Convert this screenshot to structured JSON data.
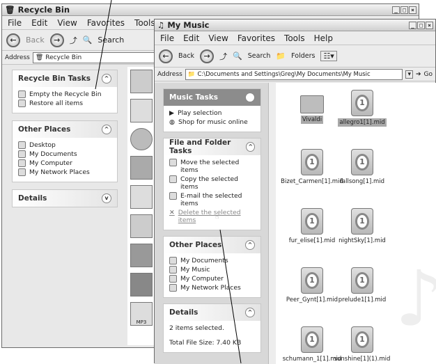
{
  "recycle": {
    "title": "Recycle Bin",
    "menu": [
      "File",
      "Edit",
      "View",
      "Favorites",
      "Tools"
    ],
    "toolbar": {
      "back": "Back",
      "search": "Search"
    },
    "address_label": "Address",
    "address_value": "Recycle Bin",
    "tasks_header": "Recycle Bin Tasks",
    "tasks": [
      "Empty the Recycle Bin",
      "Restore all items"
    ],
    "places_header": "Other Places",
    "places": [
      "Desktop",
      "My Documents",
      "My Computer",
      "My Network Places"
    ],
    "details_header": "Details",
    "strip_label": "MP3"
  },
  "music": {
    "title": "My Music",
    "menu": [
      "File",
      "Edit",
      "View",
      "Favorites",
      "Tools",
      "Help"
    ],
    "toolbar": {
      "back": "Back",
      "search": "Search",
      "folders": "Folders"
    },
    "address_label": "Address",
    "address_value": "C:\\Documents and Settings\\Greg\\My Documents\\My Music",
    "go": "Go",
    "music_tasks_header": "Music Tasks",
    "music_tasks": [
      "Play selection",
      "Shop for music online"
    ],
    "ff_header": "File and Folder Tasks",
    "ff_tasks": [
      "Move the selected items",
      "Copy the selected items",
      "E-mail the selected items",
      "Delete the selected items"
    ],
    "places_header": "Other Places",
    "places": [
      "My Documents",
      "My Music",
      "My Computer",
      "My Network Places"
    ],
    "details_header": "Details",
    "details_text": "2 items selected.",
    "details_size": "Total File Size: 7.40 KB",
    "files": [
      "Vivaldi",
      "allegro1[1].mid",
      "Bizet_Carmen[1].mid",
      "fallsong[1].mid",
      "fur_elise[1].mid",
      "nightSky[1].mid",
      "Peer_Gynt[1].mid",
      "prelude1[1].mid",
      "schumann_1[1].mid",
      "sunshine[1](1).mid"
    ]
  }
}
